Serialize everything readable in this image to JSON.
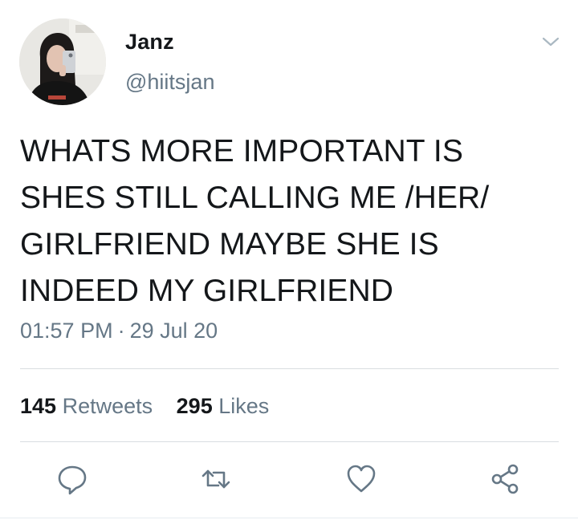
{
  "tweet": {
    "author": {
      "display_name": "Janz",
      "handle": "@hiitsjan"
    },
    "text": "WHATS MORE IMPORTANT IS\nSHES STILL CALLING ME /HER/\nGIRLFRIEND MAYBE SHE IS\nINDEED MY GIRLFRIEND",
    "time": "01:57 PM",
    "separator": "·",
    "date": "29 Jul 20",
    "stats": {
      "retweets_count": "145",
      "retweets_label": "Retweets",
      "likes_count": "295",
      "likes_label": "Likes"
    }
  },
  "colors": {
    "text_primary": "#14171a",
    "text_secondary": "#657786",
    "icon": "#657786",
    "divider": "#d9dde1"
  },
  "icons": {
    "caret": "chevron-down-icon",
    "reply": "reply-icon",
    "retweet": "retweet-icon",
    "like": "heart-icon",
    "share": "share-icon"
  }
}
